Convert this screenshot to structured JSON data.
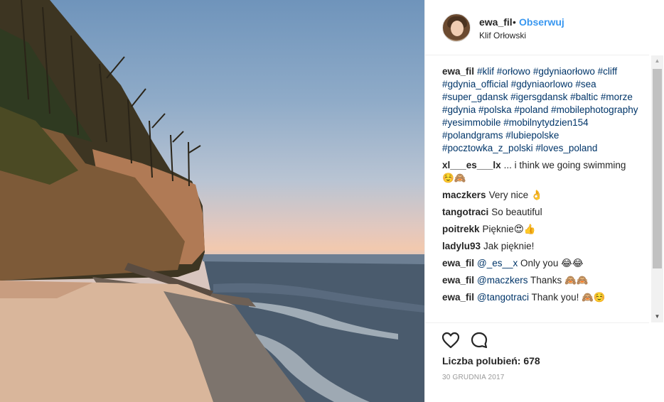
{
  "post": {
    "username": "ewa_fil",
    "separator": "•",
    "follow_label": "Obserwuj",
    "location": "Klif Orłowski"
  },
  "caption": {
    "username": "ewa_fil",
    "tags": "#klif #orłowo #gdyniaorłowo #cliff #gdynia_official #gdyniaorlowo #sea #super_gdansk #igersgdansk #baltic #morze #gdynia #polska #poland #mobilephotography #yesimmobile #mobilnytydzien154 #polandgrams #lubiepolske #pocztowka_z_polski #loves_poland"
  },
  "comments": [
    {
      "username": "xl___es___lx",
      "text": "... i think we going swimming ☺️🙈"
    },
    {
      "username": "maczkers",
      "text": "Very nice 👌"
    },
    {
      "username": "tangotraci",
      "text": "So beautiful"
    },
    {
      "username": "poitrekk",
      "text": "Pięknie😍👍"
    },
    {
      "username": "ladylu93",
      "text": "Jak pięknie!"
    },
    {
      "username": "ewa_fil",
      "mention": "@_es__x",
      "text": "Only you 😂😂"
    },
    {
      "username": "ewa_fil",
      "mention": "@maczkers",
      "text": "Thanks 🙈🙈"
    },
    {
      "username": "ewa_fil",
      "mention": "@tangotraci",
      "text": "Thank you! 🙈☺️"
    }
  ],
  "actions": {
    "like_icon": "heart-outline-icon",
    "comment_icon": "speech-bubble-icon"
  },
  "likes_text": "Liczba polubień: 678",
  "date": "30 GRUDNIA 2017",
  "scrollbar": {
    "up_icon": "▲",
    "down_icon": "▼"
  },
  "colors": {
    "link": "#3897f0",
    "hashtag": "#003569",
    "date": "#999999",
    "divider": "#efefef"
  }
}
